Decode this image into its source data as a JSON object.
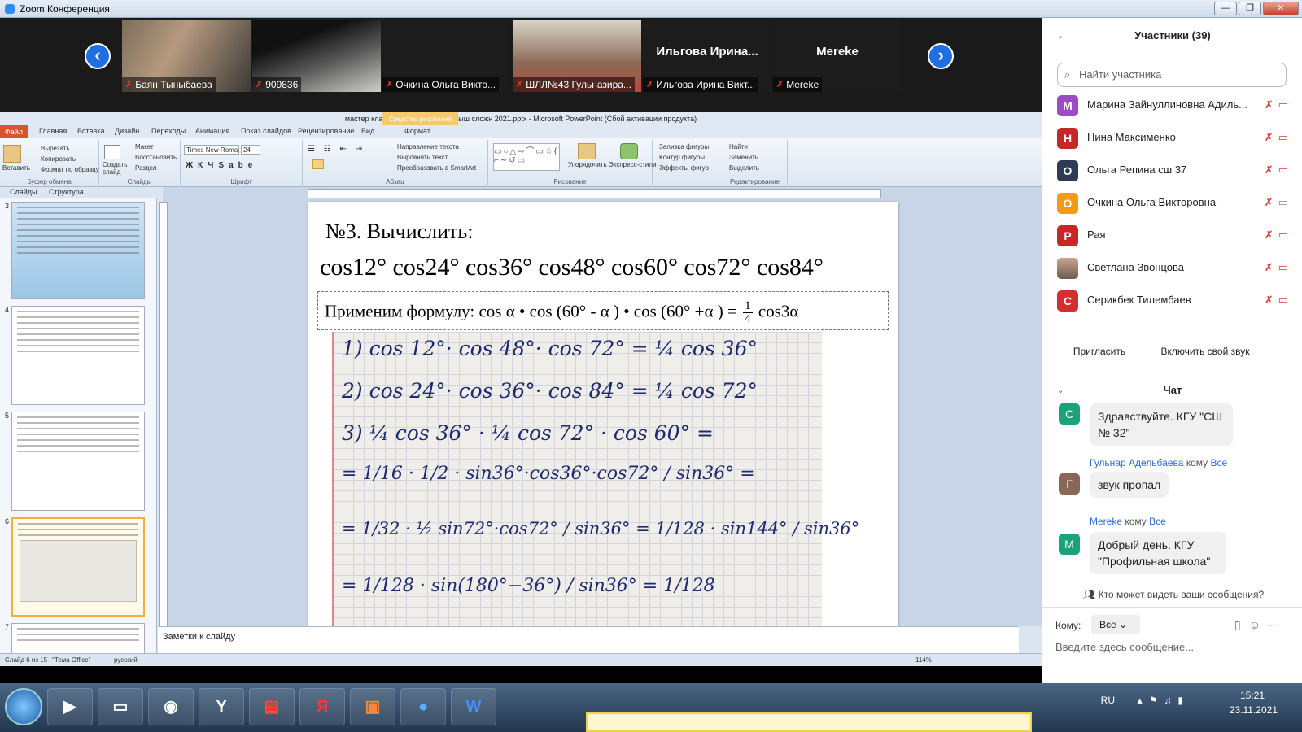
{
  "window": {
    "title": "Zoom Конференция",
    "min": "—",
    "max": "❐",
    "close": "✕"
  },
  "gallery": {
    "prev": "‹",
    "next": "›",
    "tiles": [
      {
        "name": "Баян Тыныбаева"
      },
      {
        "name": "909836"
      },
      {
        "name": "Очкина Ольга Викто..."
      },
      {
        "name": "ШЛЛ№43 Гульназира..."
      },
      {
        "name": "Ильгова Ирина Викт...",
        "big": "Ильгова  Ирина..."
      },
      {
        "name": "Mereke",
        "big": "Mereke"
      }
    ]
  },
  "ppt": {
    "title": "мастер класс Решение задач повыш сложн 2021.pptx  -  Microsoft PowerPoint (Сбой активации продукта)",
    "context_tab": "Средства рисования",
    "tabs": [
      "Файл",
      "Главная",
      "Вставка",
      "Дизайн",
      "Переходы",
      "Анимация",
      "Показ слайдов",
      "Рецензирование",
      "Вид",
      "Формат"
    ],
    "ribbon": {
      "paste": "Вставить",
      "cut": "Вырезать",
      "copy": "Копировать",
      "format_painter": "Формат по образцу",
      "new_slide": "Создать слайд",
      "layout": "Макет",
      "reset": "Восстановить",
      "section": "Раздел",
      "font_name": "Times New Roma",
      "font_size": "24",
      "text_dir": "Направление текста",
      "align_text": "Выровнять текст",
      "smartart": "Преобразовать в SmartArt",
      "arrange": "Упорядочить",
      "quick_styles": "Экспресс-стили",
      "shape_fill": "Заливка фигуры",
      "shape_outline": "Контур фигуры",
      "shape_effects": "Эффекты фигур",
      "find": "Найти",
      "replace": "Заменить",
      "select": "Выделить",
      "groups": [
        "Буфер обмена",
        "Слайды",
        "Шрифт",
        "Абзац",
        "Рисование",
        "Редактирование"
      ]
    },
    "panel_tabs": [
      "Слайды",
      "Структура"
    ],
    "thumb_numbers": [
      "3",
      "4",
      "5",
      "6",
      "7"
    ],
    "slide": {
      "title": "№3. Вычислить:",
      "expr": "cos12° cos24° cos36° cos48° cos60° cos72° cos84°",
      "formula_prefix": "Применим  формулу: cos α • cos (60° - α ) • cos (60° +α ) =",
      "frac_num": "1",
      "frac_den": "4",
      "formula_suffix": "cos3α",
      "hw": [
        "1)  cos 12°· cos 48°· cos 72° = ¼ cos 36°",
        "2)  cos 24°· cos 36°· cos 84° = ¼ cos 72°",
        "3)  ¼ cos 36° · ¼ cos 72° · cos 60° =",
        "= 1/16 · 1/2 · sin36°·cos36°·cos72° / sin36° =",
        "= 1/32 · ½ sin72°·cos72° / sin36° = 1/128 · sin144° / sin36°",
        "= 1/128 · sin(180°−36°) / sin36° = 1/128"
      ]
    },
    "notes_placeholder": "Заметки к слайду",
    "status": {
      "slide": "Слайд 6 из 15",
      "theme": "\"Тема Office\"",
      "lang": "русский",
      "zoom": "114%"
    }
  },
  "participants": {
    "header": "Участники (39)",
    "search_placeholder": "Найти участника",
    "list": [
      {
        "initial": "М",
        "name": "Марина Зайнуллиновна Адиль...",
        "color": "#9c4dc4"
      },
      {
        "initial": "Н",
        "name": "Нина Максименко",
        "color": "#c62828"
      },
      {
        "initial": "О",
        "name": "Ольга Репина сш 37",
        "color": "#2e3b55"
      },
      {
        "initial": "О",
        "name": "Очкина Ольга Викторовна",
        "color": "#f59a17"
      },
      {
        "initial": "Р",
        "name": "Рая",
        "color": "#c62828"
      },
      {
        "initial": "",
        "name": "Светлана Звонцова",
        "color": "#8a7a6a"
      },
      {
        "initial": "С",
        "name": "Серикбек Тилембаев",
        "color": "#d32f2f"
      }
    ],
    "invite": "Пригласить",
    "unmute": "Включить свой звук"
  },
  "chat": {
    "header": "Чат",
    "messages": [
      {
        "initial": "С",
        "color": "#1aa37a",
        "sender": "",
        "to": "",
        "text": "Здравствуйте. КГУ \"СШ № 32\""
      },
      {
        "initial": "Г",
        "color": "#8a6656",
        "sender": "Гульнар Адельбаева",
        "to": "Все",
        "text": "звук пропал"
      },
      {
        "initial": "M",
        "color": "#1aa37a",
        "sender": "Mereke",
        "to": "Все",
        "text": "Добрый день. КГУ \"Профильная школа\""
      }
    ],
    "to_word": "кому",
    "who_can_see": "Кто может видеть ваши сообщения?",
    "to_label": "Кому:",
    "to_value": "Все",
    "input_placeholder": "Введите здесь сообщение..."
  },
  "taskbar": {
    "lang": "RU",
    "time": "15:21",
    "date": "23.11.2021",
    "apps": [
      "media-player",
      "explorer",
      "chrome",
      "yandex-browser",
      "pdf",
      "yandex",
      "powerpoint",
      "zoom",
      "word"
    ]
  }
}
